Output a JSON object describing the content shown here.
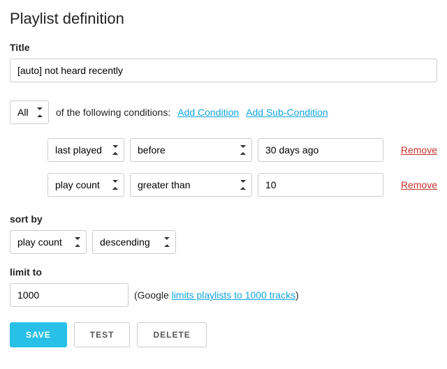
{
  "page_title": "Playlist definition",
  "title_label": "Title",
  "title_value": "[auto] not heard recently",
  "match": {
    "mode": "All",
    "suffix": "of the following conditions:",
    "add_condition": "Add Condition",
    "add_subcondition": "Add Sub-Condition"
  },
  "conditions": [
    {
      "field": "last played",
      "op": "before",
      "value": "30 days ago",
      "remove": "Remove"
    },
    {
      "field": "play count",
      "op": "greater than",
      "value": "10",
      "remove": "Remove"
    }
  ],
  "sort": {
    "label": "sort by",
    "field": "play count",
    "direction": "descending"
  },
  "limit": {
    "label": "limit to",
    "value": "1000",
    "note_prefix": "(Google ",
    "note_link": "limits playlists to 1000 tracks",
    "note_suffix": ")"
  },
  "buttons": {
    "save": "Save",
    "test": "Test",
    "delete": "Delete"
  }
}
